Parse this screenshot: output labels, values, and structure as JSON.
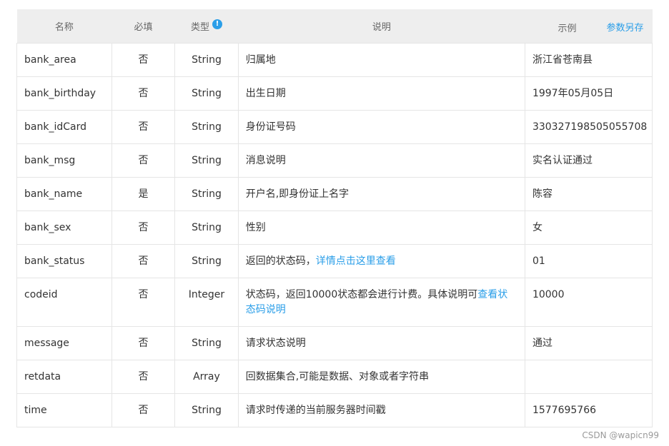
{
  "header": {
    "name": "名称",
    "required": "必填",
    "type": "类型",
    "info_icon": "!",
    "desc": "说明",
    "example": "示例",
    "save_link": "参数另存"
  },
  "rows": [
    {
      "name": "bank_area",
      "required": "否",
      "type": "String",
      "desc": "归属地",
      "example": "浙江省苍南县"
    },
    {
      "name": "bank_birthday",
      "required": "否",
      "type": "String",
      "desc": "出生日期",
      "example": "1997年05月05日"
    },
    {
      "name": "bank_idCard",
      "required": "否",
      "type": "String",
      "desc": "身份证号码",
      "example": "330327198505055708"
    },
    {
      "name": "bank_msg",
      "required": "否",
      "type": "String",
      "desc": "消息说明",
      "example": "实名认证通过"
    },
    {
      "name": "bank_name",
      "required": "是",
      "type": "String",
      "desc": "开户名,即身份证上名字",
      "example": "陈容"
    },
    {
      "name": "bank_sex",
      "required": "否",
      "type": "String",
      "desc": "性别",
      "example": "女"
    },
    {
      "name": "bank_status",
      "required": "否",
      "type": "String",
      "desc": "返回的状态码，",
      "desc_link": "详情点击这里查看",
      "example": "01"
    },
    {
      "name": "codeid",
      "required": "否",
      "type": "Integer",
      "desc": "状态码，返回10000状态都会进行计费。具体说明可",
      "desc_link": "查看状态码说明",
      "example": "10000"
    },
    {
      "name": "message",
      "required": "否",
      "type": "String",
      "desc": "请求状态说明",
      "example": "通过"
    },
    {
      "name": "retdata",
      "required": "否",
      "type": "Array",
      "desc": "回数据集合,可能是数据、对象或者字符串",
      "example": ""
    },
    {
      "name": "time",
      "required": "否",
      "type": "String",
      "desc": "请求时传递的当前服务器时间戳",
      "example": "1577695766"
    }
  ],
  "watermark": "CSDN @wapicn99",
  "colors": {
    "header_bg": "#eeeeee",
    "link": "#2a9ee8",
    "border": "#e5e5e5"
  }
}
